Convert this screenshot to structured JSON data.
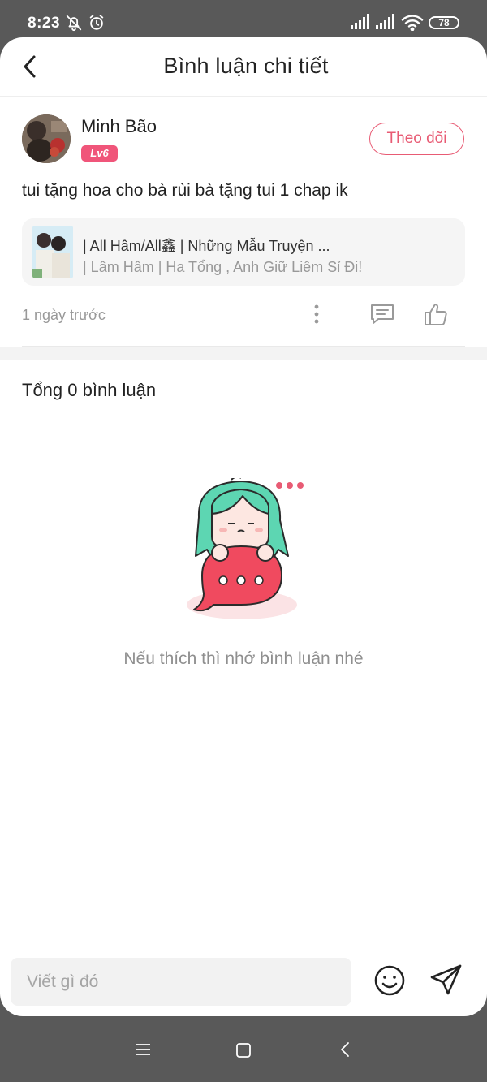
{
  "status_bar": {
    "time": "8:23",
    "battery": "78",
    "icons": [
      "bell-off-icon",
      "alarm-icon",
      "signal-icon",
      "signal-icon",
      "wifi-icon",
      "battery-icon"
    ]
  },
  "header": {
    "title": "Bình luận chi tiết",
    "back_icon": "chevron-left-icon"
  },
  "post": {
    "username": "Minh Bão",
    "level": "Lv6",
    "follow_label": "Theo dõi",
    "text": "tui tặng hoa cho bà rùi bà tặng tui 1 chap ik",
    "story": {
      "title": "| All Hâm/All鑫 | Những Mẫu Truyện ...",
      "subtitle": "| Lâm Hâm | Ha Tổng , Anh Giữ Liêm Sỉ Đi!"
    },
    "time": "1 ngày trước",
    "actions": [
      "more-vertical-icon",
      "comment-icon",
      "thumbs-up-icon"
    ]
  },
  "comments": {
    "total": "Tổng 0 bình luận",
    "empty_message": "Nếu thích thì nhớ bình luận nhé"
  },
  "composer": {
    "placeholder": "Viết gì đó",
    "value": "",
    "emoji_icon": "smiley-icon",
    "send_icon": "send-icon"
  },
  "nav_bar": {
    "icons": [
      "menu-icon",
      "home-square-icon",
      "back-icon"
    ]
  },
  "colors": {
    "accent": "#e85b74",
    "badge": "#f0557a",
    "system_bar": "#595959",
    "muted_text": "#999999"
  }
}
